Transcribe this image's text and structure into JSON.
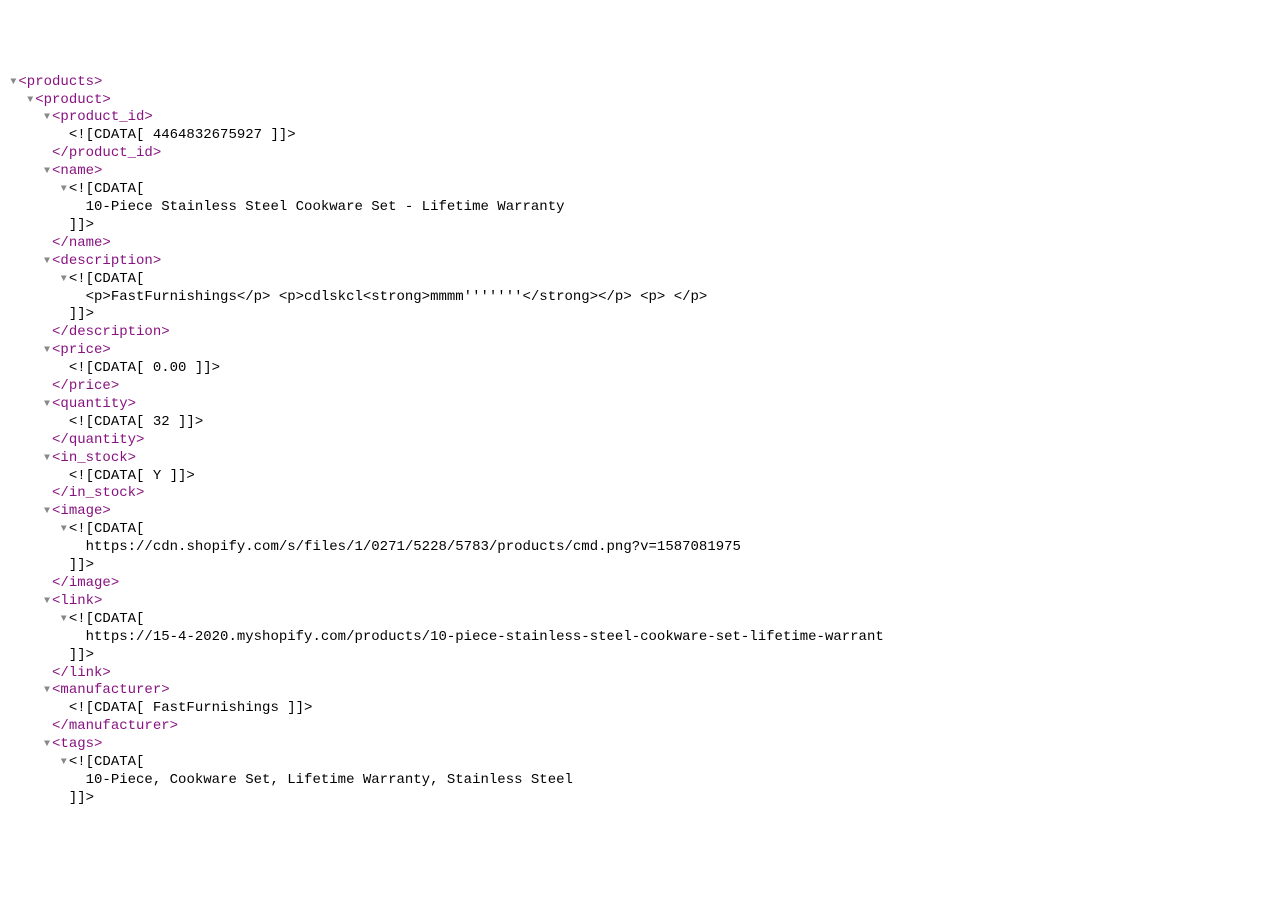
{
  "glyphs": {
    "open": "▼"
  },
  "indent": {
    "i0": " ",
    "i1": "   ",
    "i2": "     ",
    "i3": "       ",
    "i4": "         "
  },
  "l": [
    {
      "arrow": true,
      "pad": "i0",
      "cls": "tag",
      "txt": "<products>"
    },
    {
      "arrow": true,
      "pad": "i1",
      "cls": "tag",
      "txt": "<product>"
    },
    {
      "arrow": true,
      "pad": "i2",
      "cls": "tag",
      "txt": "<product_id>"
    },
    {
      "arrow": false,
      "pad": "i3",
      "cls": "text",
      "txt": "<![CDATA[ 4464832675927 ]]>"
    },
    {
      "arrow": false,
      "pad": "i2",
      "cls": "tag",
      "txt": "</product_id>"
    },
    {
      "arrow": true,
      "pad": "i2",
      "cls": "tag",
      "txt": "<name>"
    },
    {
      "arrow": true,
      "pad": "i3",
      "cls": "text",
      "txt": "<![CDATA["
    },
    {
      "arrow": false,
      "pad": "i4",
      "cls": "text",
      "txt": "10-Piece Stainless Steel Cookware Set - Lifetime Warranty"
    },
    {
      "arrow": false,
      "pad": "i3",
      "cls": "text",
      "txt": "]]>"
    },
    {
      "arrow": false,
      "pad": "i2",
      "cls": "tag",
      "txt": "</name>"
    },
    {
      "arrow": true,
      "pad": "i2",
      "cls": "tag",
      "txt": "<description>"
    },
    {
      "arrow": true,
      "pad": "i3",
      "cls": "text",
      "txt": "<![CDATA["
    },
    {
      "arrow": false,
      "pad": "i4",
      "cls": "text",
      "txt": "<p>FastFurnishings</p> <p>cdlskcl<strong>mmmm'''''''</strong></p> <p> </p>"
    },
    {
      "arrow": false,
      "pad": "i3",
      "cls": "text",
      "txt": "]]>"
    },
    {
      "arrow": false,
      "pad": "i2",
      "cls": "tag",
      "txt": "</description>"
    },
    {
      "arrow": true,
      "pad": "i2",
      "cls": "tag",
      "txt": "<price>"
    },
    {
      "arrow": false,
      "pad": "i3",
      "cls": "text",
      "txt": "<![CDATA[ 0.00 ]]>"
    },
    {
      "arrow": false,
      "pad": "i2",
      "cls": "tag",
      "txt": "</price>"
    },
    {
      "arrow": true,
      "pad": "i2",
      "cls": "tag",
      "txt": "<quantity>"
    },
    {
      "arrow": false,
      "pad": "i3",
      "cls": "text",
      "txt": "<![CDATA[ 32 ]]>"
    },
    {
      "arrow": false,
      "pad": "i2",
      "cls": "tag",
      "txt": "</quantity>"
    },
    {
      "arrow": true,
      "pad": "i2",
      "cls": "tag",
      "txt": "<in_stock>"
    },
    {
      "arrow": false,
      "pad": "i3",
      "cls": "text",
      "txt": "<![CDATA[ Y ]]>"
    },
    {
      "arrow": false,
      "pad": "i2",
      "cls": "tag",
      "txt": "</in_stock>"
    },
    {
      "arrow": true,
      "pad": "i2",
      "cls": "tag",
      "txt": "<image>"
    },
    {
      "arrow": true,
      "pad": "i3",
      "cls": "text",
      "txt": "<![CDATA["
    },
    {
      "arrow": false,
      "pad": "i4",
      "cls": "text",
      "txt": "https://cdn.shopify.com/s/files/1/0271/5228/5783/products/cmd.png?v=1587081975"
    },
    {
      "arrow": false,
      "pad": "i3",
      "cls": "text",
      "txt": "]]>"
    },
    {
      "arrow": false,
      "pad": "i2",
      "cls": "tag",
      "txt": "</image>"
    },
    {
      "arrow": true,
      "pad": "i2",
      "cls": "tag",
      "txt": "<link>"
    },
    {
      "arrow": true,
      "pad": "i3",
      "cls": "text",
      "txt": "<![CDATA["
    },
    {
      "arrow": false,
      "pad": "i4",
      "cls": "text",
      "txt": "https://15-4-2020.myshopify.com/products/10-piece-stainless-steel-cookware-set-lifetime-warrant"
    },
    {
      "arrow": false,
      "pad": "i3",
      "cls": "text",
      "txt": "]]>"
    },
    {
      "arrow": false,
      "pad": "i2",
      "cls": "tag",
      "txt": "</link>"
    },
    {
      "arrow": true,
      "pad": "i2",
      "cls": "tag",
      "txt": "<manufacturer>"
    },
    {
      "arrow": false,
      "pad": "i3",
      "cls": "text",
      "txt": "<![CDATA[ FastFurnishings ]]>"
    },
    {
      "arrow": false,
      "pad": "i2",
      "cls": "tag",
      "txt": "</manufacturer>"
    },
    {
      "arrow": true,
      "pad": "i2",
      "cls": "tag",
      "txt": "<tags>"
    },
    {
      "arrow": true,
      "pad": "i3",
      "cls": "text",
      "txt": "<![CDATA["
    },
    {
      "arrow": false,
      "pad": "i4",
      "cls": "text",
      "txt": "10-Piece, Cookware Set, Lifetime Warranty, Stainless Steel"
    },
    {
      "arrow": false,
      "pad": "i3",
      "cls": "text",
      "txt": "]]>"
    }
  ]
}
